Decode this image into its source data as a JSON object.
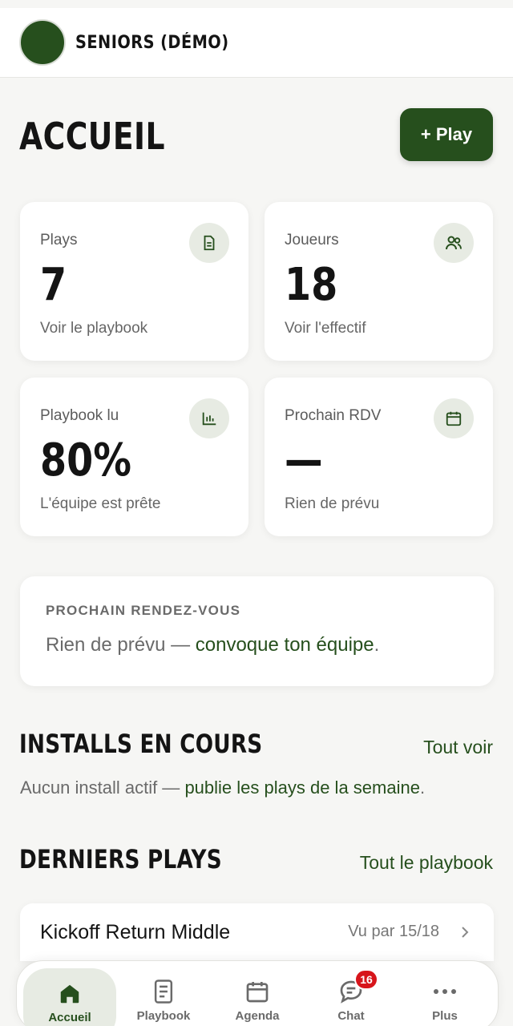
{
  "header": {
    "team_name": "SENIORS (DÉMO)"
  },
  "page": {
    "title": "ACCUEIL",
    "add_play_label": "+ Play"
  },
  "stats": [
    {
      "label": "Plays",
      "value": "7",
      "sub": "Voir le playbook",
      "icon": "document-icon"
    },
    {
      "label": "Joueurs",
      "value": "18",
      "sub": "Voir l'effectif",
      "icon": "users-icon"
    },
    {
      "label": "Playbook lu",
      "value": "80%",
      "sub": "L'équipe est prête",
      "icon": "bar-chart-icon"
    },
    {
      "label": "Prochain RDV",
      "value": "—",
      "sub": "Rien de prévu",
      "icon": "calendar-icon"
    }
  ],
  "next_meeting": {
    "title": "PROCHAIN RENDEZ-VOUS",
    "text_prefix": "Rien de prévu — ",
    "link": "convoque ton équipe",
    "text_suffix": "."
  },
  "installs": {
    "title": "INSTALLS EN COURS",
    "see_all": "Tout voir",
    "empty_prefix": "Aucun install actif — ",
    "empty_link": "publie les plays de la semaine",
    "empty_suffix": "."
  },
  "latest_plays": {
    "title": "DERNIERS PLAYS",
    "see_all": "Tout le playbook",
    "items": [
      {
        "name": "Kickoff Return Middle",
        "seen": "Vu par 15/18"
      }
    ]
  },
  "nav": {
    "items": [
      {
        "label": "Accueil",
        "icon": "home-icon",
        "active": true
      },
      {
        "label": "Playbook",
        "icon": "notebook-icon"
      },
      {
        "label": "Agenda",
        "icon": "calendar-icon"
      },
      {
        "label": "Chat",
        "icon": "chat-icon",
        "badge": "16"
      },
      {
        "label": "Plus",
        "icon": "more-icon"
      }
    ]
  },
  "colors": {
    "accent": "#264f1d",
    "badge": "#d7151b",
    "icon_bg": "#e7ebe3"
  }
}
